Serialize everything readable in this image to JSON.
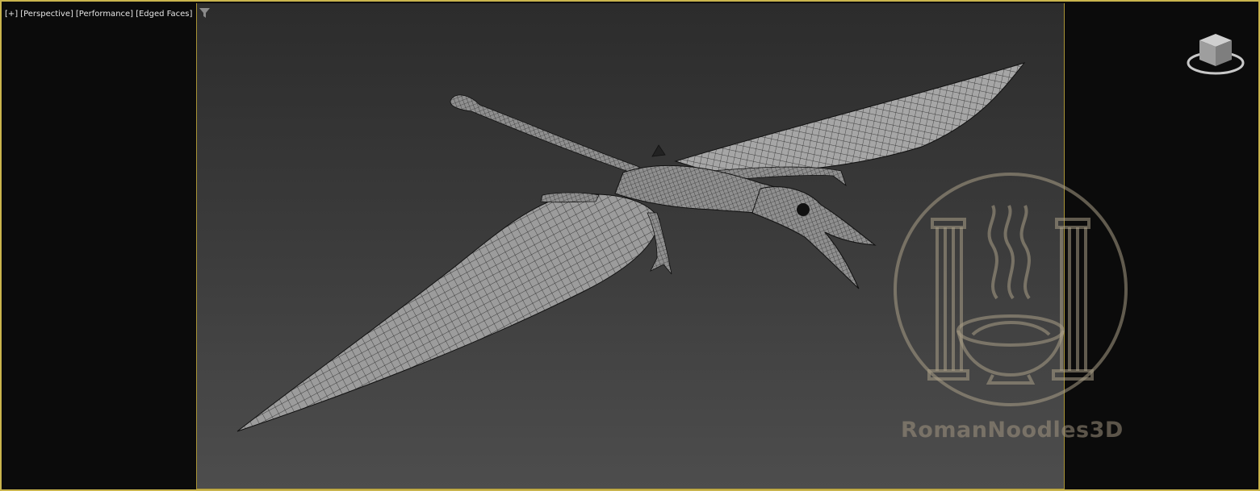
{
  "viewport": {
    "labels": [
      "[+]",
      "[Perspective]",
      "[Performance]",
      "[Edged Faces]"
    ],
    "filter_icon": "filter-funnel-icon",
    "viewcube_icon": "viewcube-icon",
    "border_color": "#c9b44e",
    "background_top": "#2c2c2c",
    "background_bottom": "#4d4d4d"
  },
  "scene": {
    "model_icon": "pterosaur-wireframe-model",
    "mesh_color": "#9a9a9a",
    "wire_color": "#1a1a1a"
  },
  "watermark": {
    "logo_icon": "roman-noodles-logo-icon",
    "text": "RomanNoodles3D",
    "color": "#a09480"
  }
}
